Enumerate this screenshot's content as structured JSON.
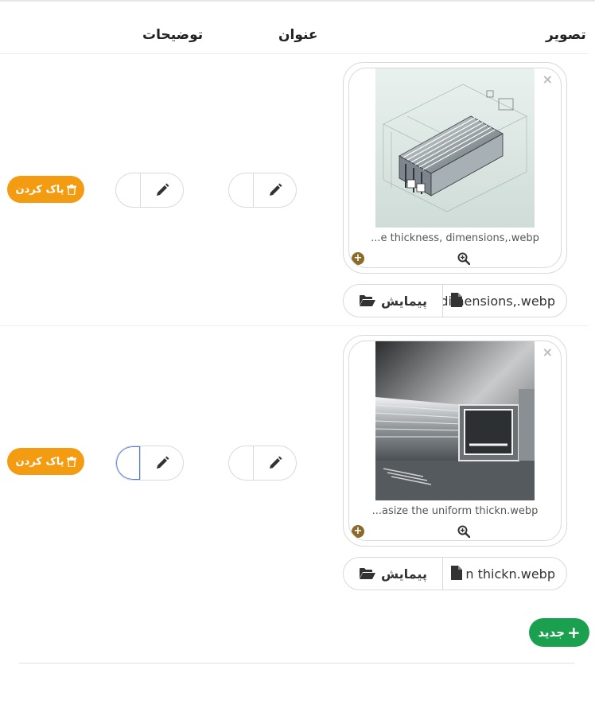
{
  "headers": {
    "image": "تصویر",
    "title": "عنوان",
    "description": "توضیحات"
  },
  "rows": [
    {
      "caption": "...e thickness, dimensions,.webp",
      "file_name": "dimensions,.webp",
      "browse_label": "پیمایش",
      "delete_label": "پاک کردن",
      "close_glyph": "×",
      "plus_glyph": "+",
      "title_value": "",
      "description_value": ""
    },
    {
      "caption": "...asize the uniform thickn.webp",
      "file_name": "n thickn.webp",
      "browse_label": "پیمایش",
      "delete_label": "پاک کردن",
      "close_glyph": "×",
      "plus_glyph": "+",
      "title_value": "",
      "description_value": ""
    }
  ],
  "new_button": {
    "label": "جدید",
    "plus_glyph": "+"
  },
  "colors": {
    "delete": "#f39c12",
    "new": "#1aa04f",
    "badge": "#8b6a2a",
    "focus": "#4a7fd4"
  }
}
